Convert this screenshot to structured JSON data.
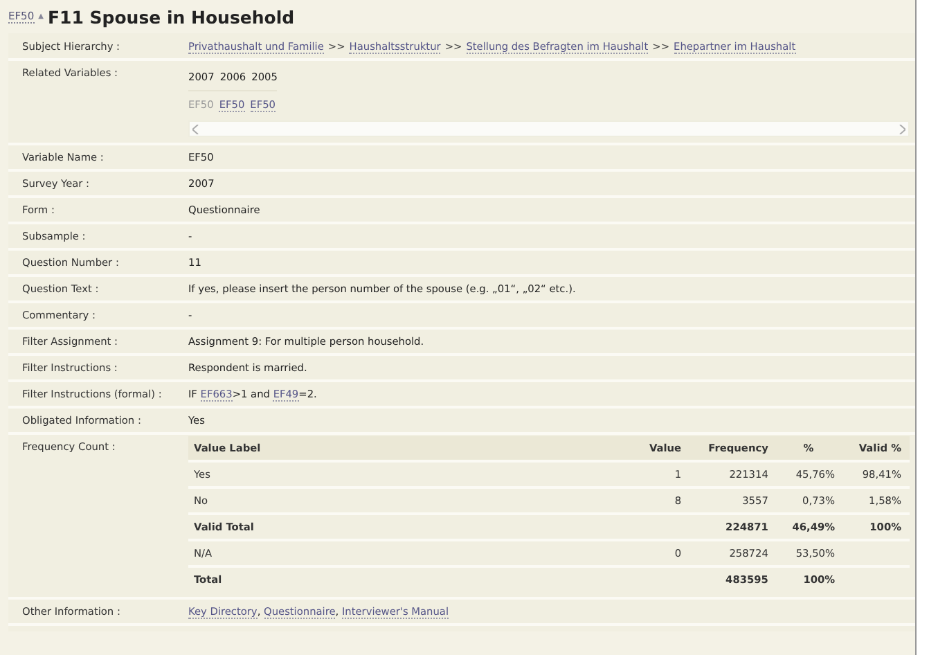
{
  "breadcrumb": {
    "link": "EF50",
    "arrow": "▲",
    "title": "F11 Spouse in Household"
  },
  "rows": [
    {
      "label": "Subject Hierarchy :",
      "kind": "path",
      "separator": ">>",
      "items": [
        "Privathaushalt und Familie",
        "Haushaltsstruktur",
        "Stellung des Befragten im Haushalt",
        "Ehepartner im Haushalt"
      ]
    },
    {
      "label": "Related Variables :",
      "kind": "related",
      "years": [
        "2007",
        "2006",
        "2005"
      ],
      "variables": [
        {
          "text": "EF50",
          "current": true
        },
        {
          "text": "EF50",
          "current": false
        },
        {
          "text": "EF50",
          "current": false
        }
      ]
    },
    {
      "label": "Variable Name :",
      "kind": "text",
      "value": "EF50"
    },
    {
      "label": "Survey Year :",
      "kind": "text",
      "value": "2007"
    },
    {
      "label": "Form :",
      "kind": "text",
      "value": "Questionnaire"
    },
    {
      "label": "Subsample :",
      "kind": "text",
      "value": "-"
    },
    {
      "label": "Question Number :",
      "kind": "text",
      "value": "11"
    },
    {
      "label": "Question Text :",
      "kind": "text",
      "value": "If yes, please insert the person number of the spouse (e.g. „01“, „02“ etc.)."
    },
    {
      "label": "Commentary :",
      "kind": "text",
      "value": "-"
    },
    {
      "label": "Filter Assignment :",
      "kind": "text",
      "value": "Assignment 9: For multiple person household."
    },
    {
      "label": "Filter Instructions :",
      "kind": "text",
      "value": "Respondent is married."
    },
    {
      "label": "Filter Instructions (formal) :",
      "kind": "segments",
      "segments": [
        {
          "kind": "text",
          "text": "IF "
        },
        {
          "kind": "link",
          "text": "EF663"
        },
        {
          "kind": "text",
          "text": ">1 and "
        },
        {
          "kind": "link",
          "text": "EF49"
        },
        {
          "kind": "text",
          "text": "=2."
        }
      ]
    },
    {
      "label": "Obligated Information :",
      "kind": "text",
      "value": "Yes"
    },
    {
      "label": "Frequency Count :",
      "kind": "frequency",
      "columns": [
        "Value Label",
        "Value",
        "Frequency",
        "%",
        "Valid %"
      ],
      "rows": [
        {
          "total": false,
          "cells": [
            "Yes",
            "1",
            "221314",
            "45,76%",
            "98,41%"
          ]
        },
        {
          "total": false,
          "cells": [
            "No",
            "8",
            "3557",
            "0,73%",
            "1,58%"
          ]
        },
        {
          "total": true,
          "cells": [
            "Valid Total",
            "",
            "224871",
            "46,49%",
            "100%"
          ]
        },
        {
          "total": false,
          "cells": [
            "N/A",
            "0",
            "258724",
            "53,50%",
            ""
          ]
        },
        {
          "total": true,
          "cells": [
            "Total",
            "",
            "483595",
            "100%",
            ""
          ]
        }
      ]
    },
    {
      "label": "Other Information :",
      "kind": "links",
      "separator": ", ",
      "links": [
        "Key Directory",
        "Questionnaire",
        "Interviewer's Manual"
      ]
    }
  ]
}
